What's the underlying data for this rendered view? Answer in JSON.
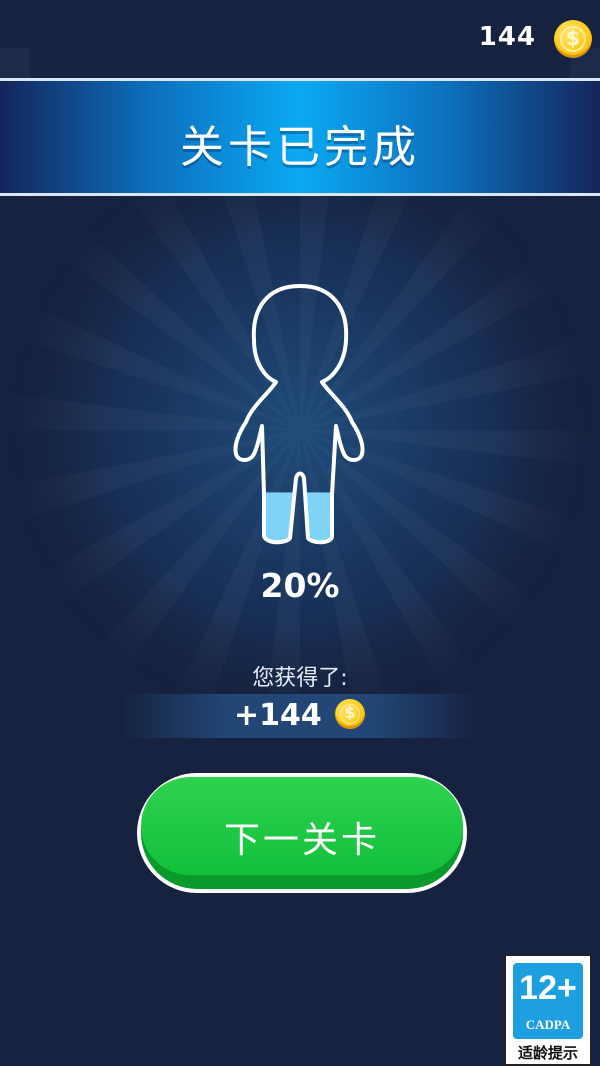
{
  "top_bar": {
    "coin_count": "144",
    "coin_icon_symbol": "$"
  },
  "banner": {
    "title": "关卡已完成"
  },
  "result": {
    "fill_percent": 20,
    "percent_text": "20%"
  },
  "reward": {
    "label": "您获得了:",
    "amount": "+144",
    "coin_icon_symbol": "$"
  },
  "next_button": {
    "label": "下一关卡"
  },
  "age_rating": {
    "rating": "12+",
    "org": "CADPA",
    "hint": "适龄提示"
  },
  "colors": {
    "background": "#16223f",
    "banner_center": "#0aa9f2",
    "button_green": "#12c03b",
    "fill_blue": "#7fd3f5",
    "coin_gold": "#ffcc1a"
  }
}
